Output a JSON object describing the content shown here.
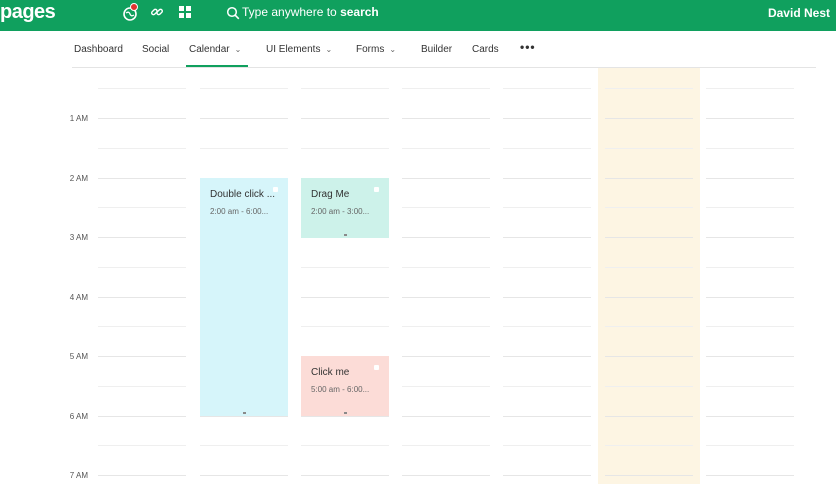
{
  "app": {
    "brand": "pages",
    "search_placeholder_prefix": "Type anywhere to ",
    "search_placeholder_bold": "search",
    "user_name": "David Nest",
    "colors": {
      "topbar": "#10a05e",
      "accent": "#10a05e",
      "today": "#fdf5e3"
    },
    "icons": [
      "globe-notification-icon",
      "link-icon",
      "apps-grid-icon",
      "search-icon"
    ]
  },
  "nav": {
    "items": [
      {
        "label": "Dashboard",
        "dropdown": false
      },
      {
        "label": "Social",
        "dropdown": false
      },
      {
        "label": "Calendar",
        "dropdown": true,
        "active": true
      },
      {
        "label": "UI Elements",
        "dropdown": true
      },
      {
        "label": "Forms",
        "dropdown": true
      },
      {
        "label": "Builder",
        "dropdown": false
      },
      {
        "label": "Cards",
        "dropdown": false
      }
    ],
    "more": "•••"
  },
  "calendar": {
    "time_labels": [
      "1 AM",
      "2 AM",
      "3 AM",
      "4 AM",
      "5 AM",
      "6 AM",
      "7 AM"
    ],
    "events": [
      {
        "title": "Double click ...",
        "time": "2:00 am - 6:00...",
        "color": "#d6f5fa"
      },
      {
        "title": "Drag Me",
        "time": "2:00 am - 3:00...",
        "color": "#cdf2ea"
      },
      {
        "title": "Click me",
        "time": "5:00 am - 6:00...",
        "color": "#fcdcd7"
      }
    ]
  }
}
